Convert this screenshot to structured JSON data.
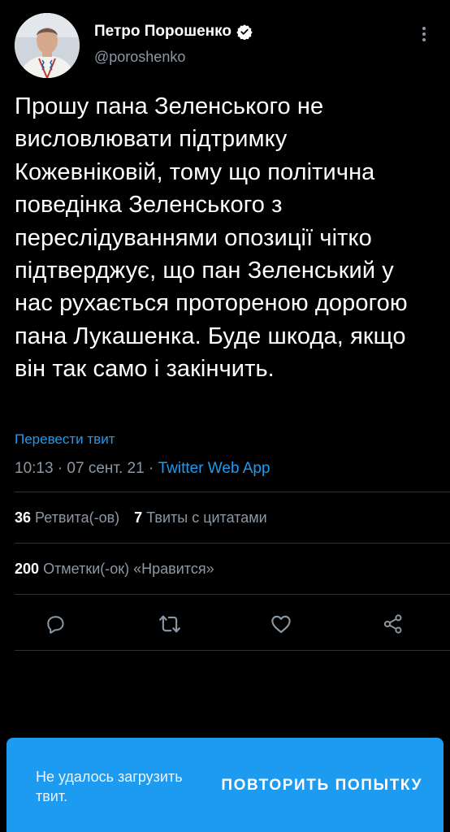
{
  "author": {
    "name": "Петро Порошенко",
    "handle": "@poroshenko",
    "verified": true
  },
  "tweet": {
    "text": "Прошу пана Зеленського не висловлювати підтримку Кожевніковій, тому що політична поведінка Зеленського з переслідуваннями опозиції чітко підтверджує, що пан Зеленський у нас рухається протореною дорогою пана Лукашенка. Буде шкода, якщо він так само і закінчить.",
    "translate_label": "Перевести твит",
    "time": "10:13 · 07 сент. 21 · ",
    "source": "Twitter Web App"
  },
  "stats": {
    "retweets_count": "36",
    "retweets_label": "Ретвита(-ов)",
    "quotes_count": "7",
    "quotes_label": "Твиты с цитатами",
    "likes_count": "200",
    "likes_label": "Отметки(-ок) «Нравится»"
  },
  "toast": {
    "message": "Не удалось загрузить твит.",
    "button": "ПОВТОРИТЬ ПОПЫТКУ"
  },
  "icons": {
    "reply": "comment-icon",
    "retweet": "retweet-icon",
    "like": "heart-icon",
    "share": "share-icon",
    "more": "more-vertical-icon"
  },
  "colors": {
    "background": "#000000",
    "accent": "#1d9bf0",
    "secondary_text": "#8b98a5",
    "divider": "#2f3336"
  }
}
